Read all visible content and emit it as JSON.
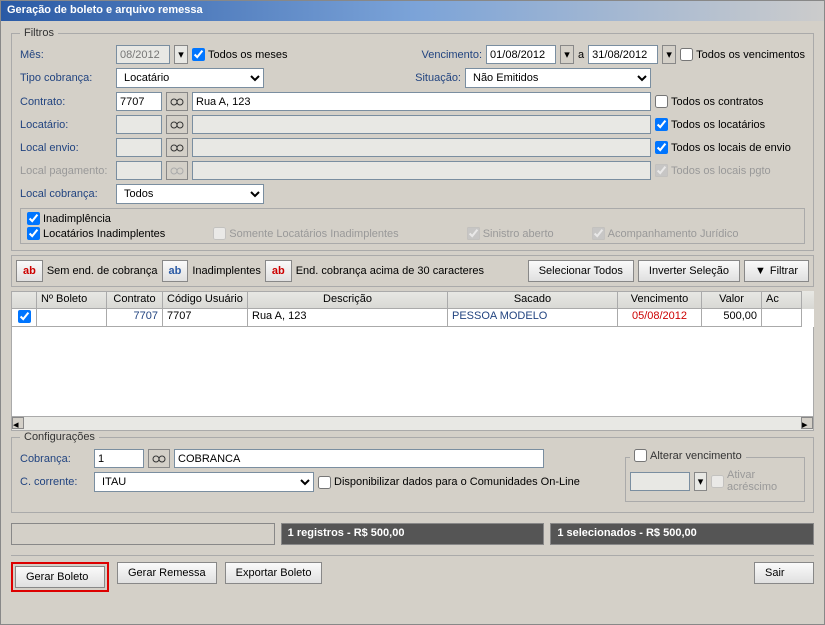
{
  "window_title": "Geração de boleto e arquivo remessa",
  "filtros": {
    "legend": "Filtros",
    "mes_label": "Mês:",
    "mes_value": "08/2012",
    "todos_meses": "Todos os meses",
    "vencimento_label": "Vencimento:",
    "venc_de": "01/08/2012",
    "a": "a",
    "venc_ate": "31/08/2012",
    "todos_vencimentos": "Todos os vencimentos",
    "tipo_cobranca_label": "Tipo cobrança:",
    "tipo_cobranca_value": "Locatário",
    "situacao_label": "Situação:",
    "situacao_value": "Não Emitidos",
    "contrato_label": "Contrato:",
    "contrato_value": "7707",
    "contrato_desc": "Rua A, 123",
    "todos_contratos": "Todos os contratos",
    "locatario_label": "Locatário:",
    "todos_locatarios": "Todos os locatários",
    "local_envio_label": "Local envio:",
    "todos_envio": "Todos os locais de envio",
    "local_pagamento_label": "Local pagamento:",
    "todos_pgto": "Todos os locais pgto",
    "local_cobranca_label": "Local cobrança:",
    "local_cobranca_value": "Todos",
    "inadimplencia": "Inadimplência",
    "locatarios_inad": "Locatários Inadimplentes",
    "somente_inad": "Somente Locatários Inadimplentes",
    "sinistro": "Sinistro aberto",
    "acomp_juridico": "Acompanhamento Jurídico"
  },
  "toolbar": {
    "sem_end": "Sem end. de cobrança",
    "inadimplentes": "Inadimplentes",
    "acima30": "End. cobrança acima de 30 caracteres",
    "sel_todos": "Selecionar Todos",
    "inv_selecao": "Inverter Seleção",
    "filtrar": "Filtrar"
  },
  "grid": {
    "headers": {
      "num_boleto": "Nº Boleto",
      "contrato": "Contrato",
      "cod_usuario": "Código Usuário",
      "descricao": "Descrição",
      "sacado": "Sacado",
      "vencimento": "Vencimento",
      "valor": "Valor",
      "ac": "Ac"
    },
    "row": {
      "contrato": "7707",
      "cod_usuario": "7707",
      "descricao": "Rua A, 123",
      "sacado": "PESSOA MODELO",
      "vencimento": "05/08/2012",
      "valor": "500,00"
    }
  },
  "config": {
    "legend": "Configurações",
    "cobranca_label": "Cobrança:",
    "cobranca_num": "1",
    "cobranca_desc": "COBRANCA",
    "ccorrente_label": "C. corrente:",
    "ccorrente_value": "ITAU",
    "disponibilizar": "Disponibilizar dados para o Comunidades On-Line",
    "alterar_venc_legend": "Alterar vencimento",
    "ativar_acrescimo": "Ativar acréscimo"
  },
  "status": {
    "registros": "1 registros - R$ 500,00",
    "selecionados": "1 selecionados - R$ 500,00"
  },
  "buttons": {
    "gerar_boleto": "Gerar  Boleto",
    "gerar_remessa": "Gerar Remessa",
    "exportar": "Exportar Boleto",
    "sair": "Sair"
  }
}
